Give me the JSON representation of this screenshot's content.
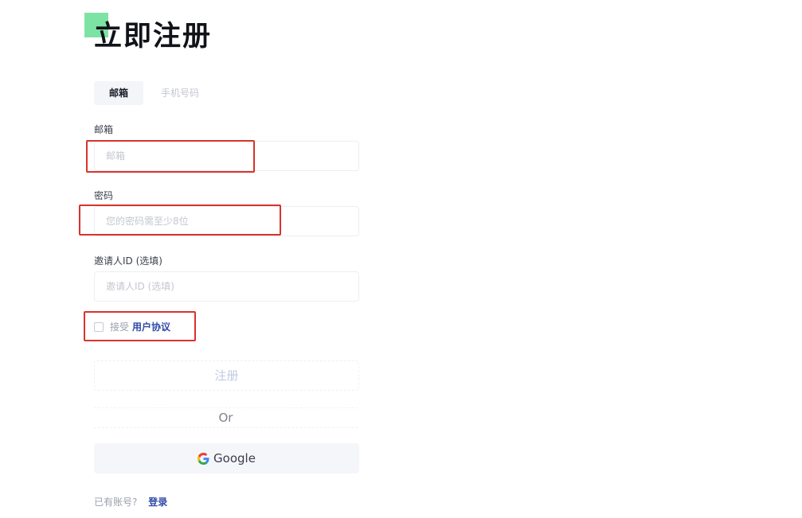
{
  "page": {
    "title": "立即注册"
  },
  "tabs": [
    {
      "label": "邮箱",
      "active": true
    },
    {
      "label": "手机号码",
      "active": false
    }
  ],
  "form": {
    "email": {
      "label": "邮箱",
      "placeholder": "邮箱",
      "value": ""
    },
    "password": {
      "label": "密码",
      "placeholder": "您的密码需至少8位",
      "value": ""
    },
    "invite": {
      "label": "邀请人ID (选填)",
      "placeholder": "邀请人ID (选填)",
      "value": ""
    },
    "agree": {
      "prefix": "接受",
      "link": "用户协议",
      "checked": false
    },
    "register_label": "注册",
    "or_label": "Or",
    "google_label": "Google"
  },
  "footer": {
    "has_account": "已有账号?",
    "login_link": "登录"
  },
  "colors": {
    "accent_green": "#7de3a5",
    "link_blue": "#2f4aa8",
    "annotation_red": "#d8332b"
  },
  "icons": {
    "google": "google-icon"
  }
}
